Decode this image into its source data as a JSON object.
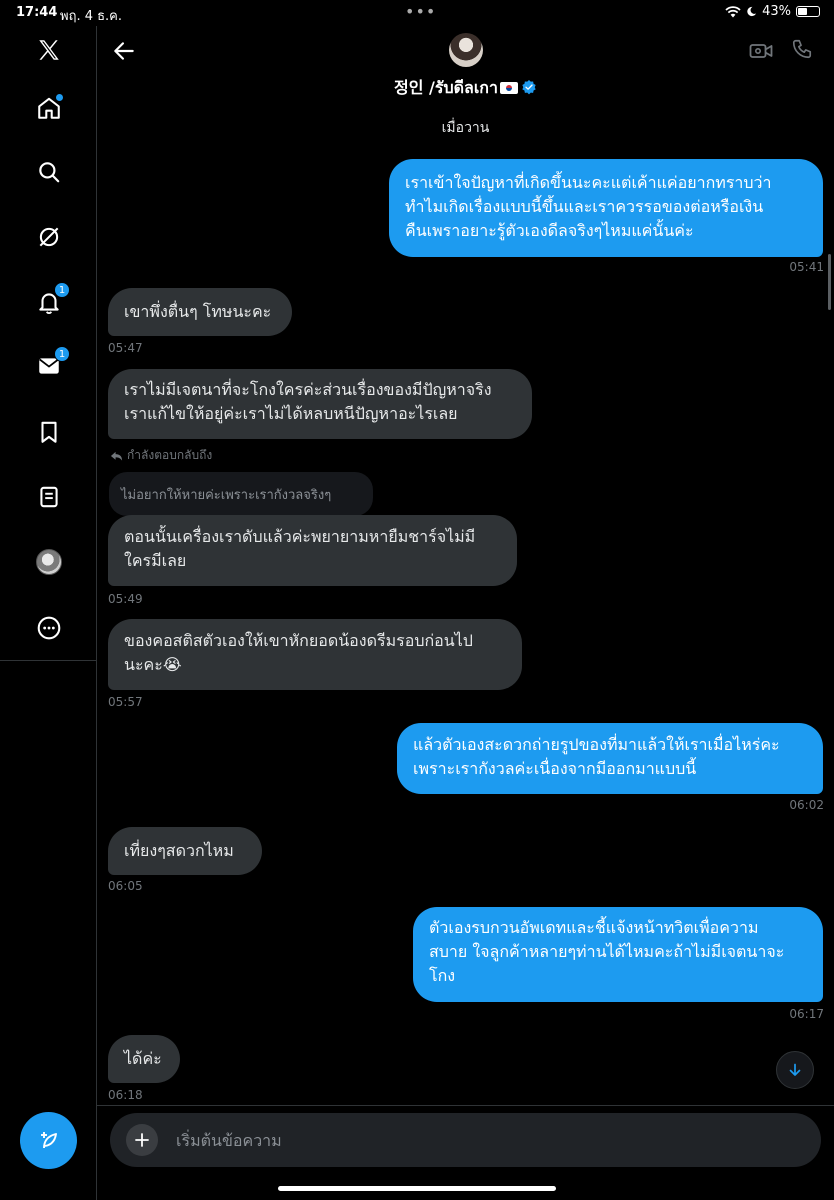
{
  "status_bar": {
    "time": "17:44",
    "date": "พฤ. 4 ธ.ค.",
    "battery": "43%",
    "battery_level": 0.43
  },
  "nav": {
    "logo": "x-logo-icon",
    "items": [
      {
        "icon": "home-icon",
        "badge": ""
      },
      {
        "icon": "search-icon",
        "badge": ""
      },
      {
        "icon": "grok-icon",
        "badge": ""
      },
      {
        "icon": "notifications-icon",
        "badge": "1"
      },
      {
        "icon": "messages-icon",
        "badge": "1"
      },
      {
        "icon": "bookmarks-icon",
        "badge": ""
      },
      {
        "icon": "lists-icon",
        "badge": ""
      },
      {
        "icon": "profile-avatar",
        "badge": ""
      },
      {
        "icon": "more-icon",
        "badge": ""
      }
    ],
    "compose_icon": "compose-post-icon"
  },
  "header": {
    "name": "정인 /รับดีลเกา",
    "verified": true
  },
  "conversation": {
    "day_label": "เมื่อวาน",
    "messages": [
      {
        "dir": "out",
        "text_lines": [
          "เราเข้าใจปัญหาที่เกิดขึ้นนะคะแต่เค้าแค่อยากทราบว่า",
          "ทำไมเกิดเรื่องแบบนี้ขึ้นและเราควรรอของต่อหรือเงิน",
          "คืนเพราอยาะรู้ตัวเองดีลจริงๆไหมแค่นั้นค่ะ"
        ],
        "time": "05:41"
      },
      {
        "dir": "in",
        "text_lines": [
          "เขาพึ่งตื่นๆ โทษนะคะ"
        ],
        "time": "05:47"
      },
      {
        "dir": "in",
        "text_lines": [
          "เราไม่มีเจตนาที่จะโกงใครค่ะส่วนเรื่องของมีปัญหาจริง",
          "เราแก้ไขให้อยู่ค่ะเราไม่ได้หลบหนีปัญหาอะไรเลย"
        ],
        "time": ""
      },
      {
        "dir": "in",
        "reply_hint": "กำลังตอบกลับถึง",
        "quoted": "ไม่อยากให้หายค่ะเพราะเรากังวลจริงๆ",
        "text_lines": [
          "ตอนนั้นเครื่องเราดับแล้วค่ะพยายามหายืมชาร์จไม่มี",
          "ใครมีเลย"
        ],
        "time": "05:49"
      },
      {
        "dir": "in",
        "text_lines": [
          "ของคอสติสตัวเองให้เขาหักยอดน้องดรีมรอบก่อนไป",
          "นะคะ😭"
        ],
        "time": "05:57"
      },
      {
        "dir": "out",
        "text_lines": [
          "แล้วตัวเองสะดวกถ่ายรูปของที่มาแล้วให้เราเมื่อไหร่คะ",
          "เพราะเรากังวลค่ะเนื่องจากมีออกมาแบบนี้"
        ],
        "time": "06:02"
      },
      {
        "dir": "in",
        "text_lines": [
          "เที่ยงๆสดวกไหม"
        ],
        "time": "06:05"
      },
      {
        "dir": "out",
        "text_lines": [
          "ตัวเองรบกวนอัพเดทและชี้แจ้งหน้าทวิตเพื่อความ",
          "สบาย ใจลูกค้าหลายๆท่านได้ไหมคะถ้าไม่มีเจตนาจะ",
          "โกง"
        ],
        "time": "06:17"
      },
      {
        "dir": "in",
        "text_lines": [
          "ได้ค่ะ"
        ],
        "time": "06:18"
      }
    ]
  },
  "composer": {
    "placeholder": "เริ่มต้นข้อความ",
    "value": ""
  },
  "colors": {
    "accent": "#1d9bf0",
    "incoming_bubble": "#2f3336",
    "background": "#000000"
  }
}
